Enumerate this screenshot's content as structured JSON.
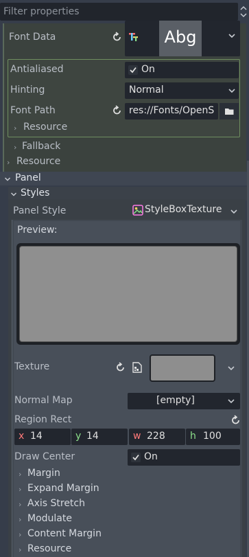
{
  "filter": {
    "placeholder": "Filter properties"
  },
  "font_data": {
    "label": "Font Data",
    "preview_text": "Abg",
    "antialiased_label": "Antialiased",
    "antialiased_value": "On",
    "hinting_label": "Hinting",
    "hinting_value": "Normal",
    "font_path_label": "Font Path",
    "font_path_value": "res://Fonts/OpenS",
    "resource_label": "Resource"
  },
  "fallback_label": "Fallback",
  "resource_label": "Resource",
  "panel": {
    "label": "Panel",
    "styles_label": "Styles",
    "panel_style_label": "Panel Style",
    "panel_style_value": "StyleBoxTexture",
    "preview_label": "Preview:",
    "texture_label": "Texture",
    "normal_map_label": "Normal Map",
    "normal_map_value": "[empty]",
    "region_rect_label": "Region Rect",
    "region": {
      "x_label": "x",
      "x": "14",
      "y_label": "y",
      "y": "14",
      "w_label": "w",
      "w": "228",
      "h_label": "h",
      "h": "100"
    },
    "draw_center_label": "Draw Center",
    "draw_center_value": "On",
    "subsections": [
      "Margin",
      "Expand Margin",
      "Axis Stretch",
      "Modulate",
      "Content Margin",
      "Resource"
    ]
  },
  "colors": {
    "background": "#363d4a",
    "field_bg": "#22262e",
    "font_section_border": "#6f8f60",
    "stylebox_accent": "#e0e0e0"
  }
}
